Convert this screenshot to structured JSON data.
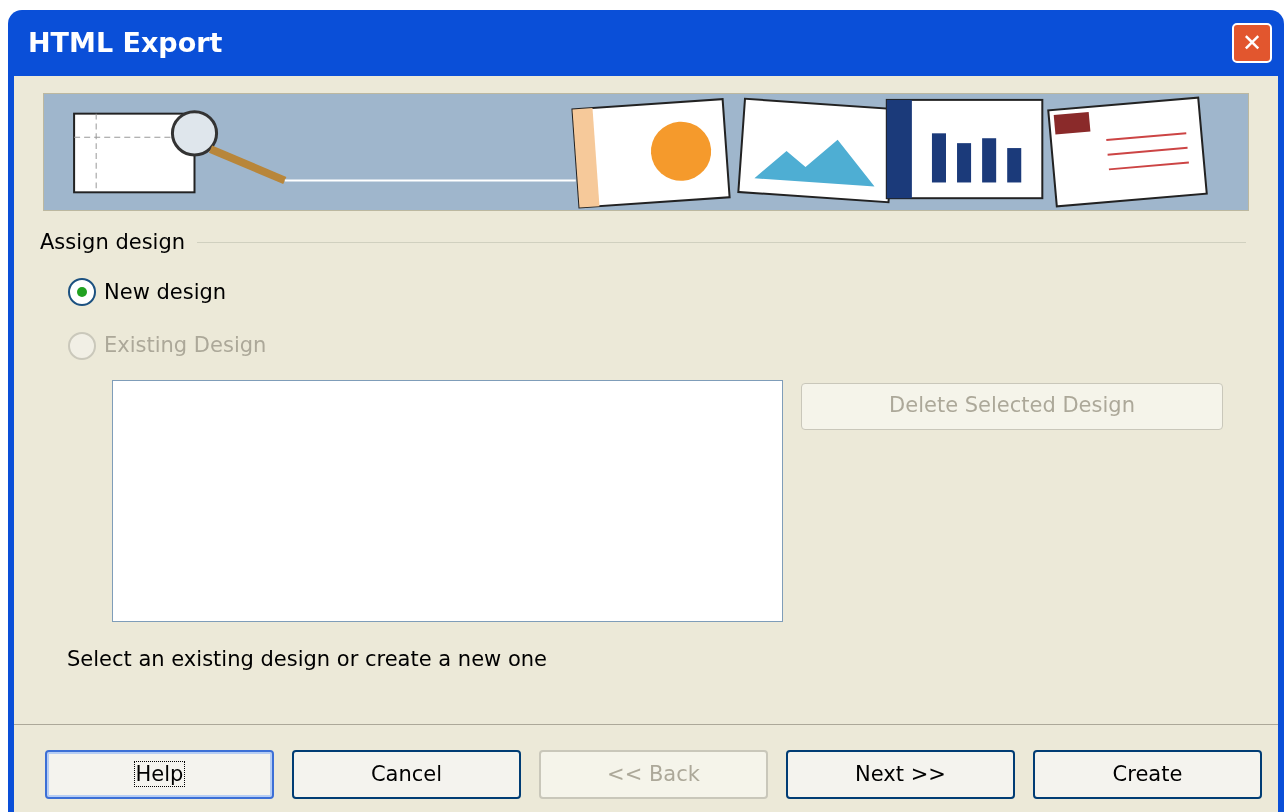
{
  "window": {
    "title": "HTML Export",
    "close_button": "✕"
  },
  "group": {
    "title": "Assign design"
  },
  "options": [
    {
      "label": "New design",
      "selected": true,
      "disabled": false
    },
    {
      "label": "Existing Design",
      "selected": false,
      "disabled": true
    }
  ],
  "delete_button": {
    "label": "Delete Selected Design",
    "disabled": true
  },
  "hint": "Select an existing design or create a new one",
  "buttons": [
    {
      "label": "Help",
      "disabled": false,
      "focused": true
    },
    {
      "label": "Cancel",
      "disabled": false,
      "focused": false
    },
    {
      "label": "<< Back",
      "disabled": true,
      "focused": false
    },
    {
      "label": "Next >>",
      "disabled": false,
      "focused": false
    },
    {
      "label": "Create",
      "disabled": false,
      "focused": false
    }
  ]
}
